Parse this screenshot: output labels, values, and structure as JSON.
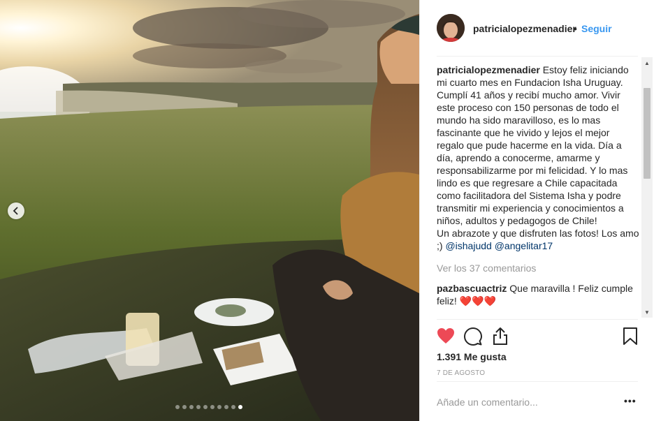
{
  "photo": {
    "prev_icon": "chevron-left-icon",
    "carousel": {
      "total": 10,
      "active_index": 9
    }
  },
  "header": {
    "username": "patricialopezmenadier",
    "separator": "•",
    "follow_label": "Seguir"
  },
  "caption": {
    "username": "patricialopezmenadier",
    "text": "Estoy feliz iniciando mi cuarto mes en Fundacion Isha Uruguay. Cumplí 41 años y recibí mucho amor. Vivir este proceso con 150 personas de todo el mundo ha sido maravilloso, es lo mas fascinante que he vivido y lejos el mejor regalo que pude hacerme en la vida. Día a día, aprendo a conocerme, amarme y responsabilizarme por mi felicidad. Y lo mas lindo es que regresare a Chile capacitada como facilitadora del Sistema Isha y podre transmitir mi experiencia y conocimientos a niños, adultos y pedagogos de Chile!",
    "text2": "Un abrazote y que disfruten las fotos! Los amo ;)",
    "mention1": "@ishajudd",
    "mention2": "@angelitar17"
  },
  "view_all_comments": "Ver los 37 comentarios",
  "comments": [
    {
      "username": "pazbascuactriz",
      "text": "Que maravilla ! Feliz cumple feliz!",
      "emoji": "❤️❤️❤️"
    }
  ],
  "actions": {
    "like_icon": "heart-filled-icon",
    "comment_icon": "comment-bubble-icon",
    "share_icon": "share-icon",
    "save_icon": "bookmark-icon",
    "like_color": "#ed4956"
  },
  "likes": "1.391 Me gusta",
  "date": "7 DE AGOSTO",
  "comment_box": {
    "placeholder": "Añade un comentario...",
    "more_label": "•••"
  }
}
